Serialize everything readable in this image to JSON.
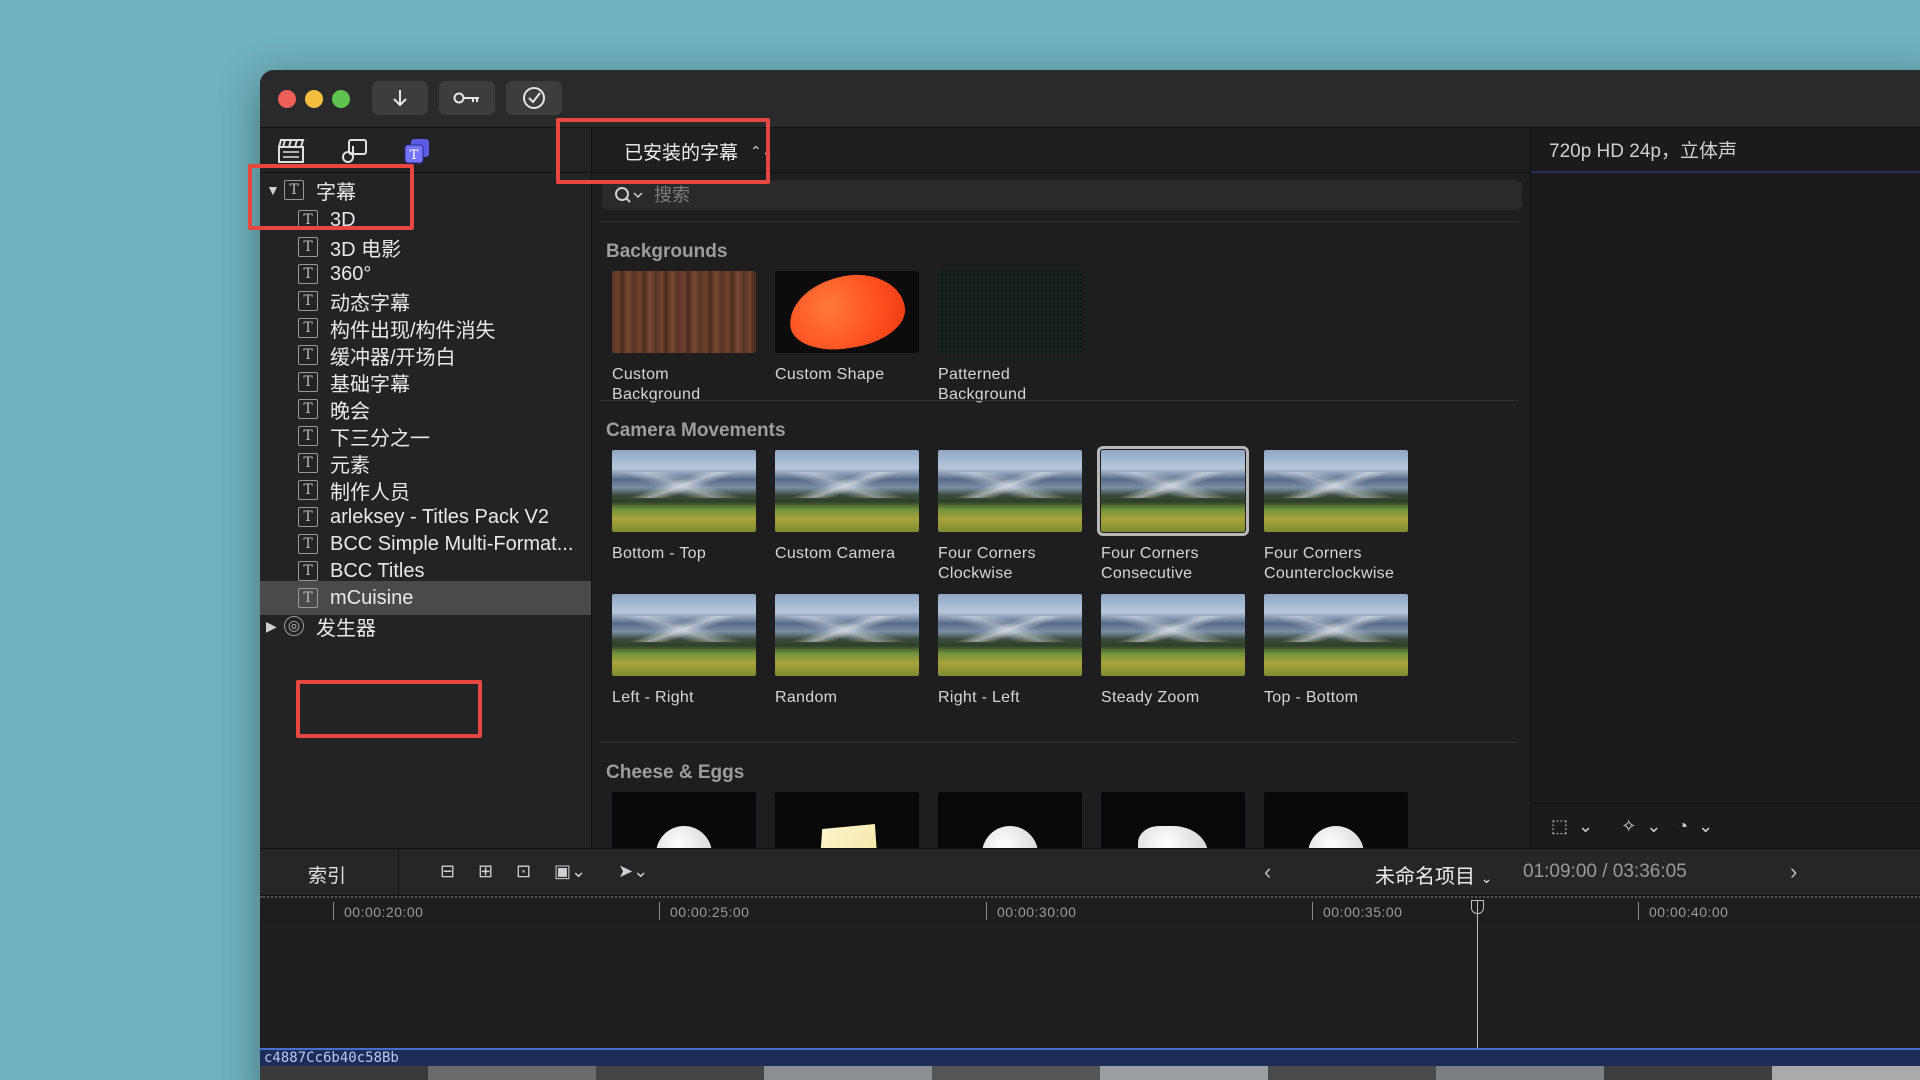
{
  "toolbar": {
    "import_icon": "arrow-down-icon",
    "keyword_icon": "key-icon",
    "background_tasks_icon": "checkmark-circle-icon"
  },
  "library_tabs": [
    {
      "icon": "clapperboard-icon"
    },
    {
      "icon": "music-photos-icon"
    },
    {
      "icon": "titles-generators-icon",
      "active": true
    }
  ],
  "sidebar": {
    "items": [
      {
        "label": "字幕",
        "expanded": true
      },
      {
        "label": "3D"
      },
      {
        "label": "3D 电影"
      },
      {
        "label": "360°"
      },
      {
        "label": "动态字幕"
      },
      {
        "label": "构件出现/构件消失"
      },
      {
        "label": "缓冲器/开场白"
      },
      {
        "label": "基础字幕"
      },
      {
        "label": "晚会"
      },
      {
        "label": "下三分之一"
      },
      {
        "label": "元素"
      },
      {
        "label": "制作人员"
      },
      {
        "label": "arleksey - Titles Pack V2"
      },
      {
        "label": "BCC Simple Multi-Format..."
      },
      {
        "label": "BCC Titles"
      },
      {
        "label": "mCuisine",
        "selected": true
      },
      {
        "label": "发生器",
        "expanded": false
      }
    ]
  },
  "browser": {
    "dropdown_label": "已安装的字幕",
    "search_placeholder": "搜索",
    "sections": [
      {
        "title": "Backgrounds",
        "tiles": [
          {
            "label": "Custom Background"
          },
          {
            "label": "Custom Shape"
          },
          {
            "label": "Patterned Background"
          }
        ]
      },
      {
        "title": "Camera Movements",
        "tiles": [
          {
            "label": "Bottom - Top"
          },
          {
            "label": "Custom Camera"
          },
          {
            "label": "Four Corners Clockwise"
          },
          {
            "label": "Four Corners Consecutive",
            "selected": true
          },
          {
            "label": "Four Corners Counterclockwise"
          },
          {
            "label": "Left - Right"
          },
          {
            "label": "Random"
          },
          {
            "label": "Right - Left"
          },
          {
            "label": "Steady Zoom"
          },
          {
            "label": "Top - Bottom"
          }
        ]
      },
      {
        "title": "Cheese & Eggs",
        "tiles": [
          {},
          {},
          {},
          {},
          {}
        ]
      }
    ]
  },
  "viewer": {
    "format": "720p HD 24p，立体声"
  },
  "timeline": {
    "index_label": "索引",
    "project_name": "未命名项目",
    "timecode": "01:09:00 / 03:36:05",
    "ruler_labels": [
      "00:00:20:00",
      "00:00:25:00",
      "00:00:30:00",
      "00:00:35:00",
      "00:00:40:00"
    ],
    "clip_name": "c4887Cc6b40c58Bb"
  },
  "colors": {
    "annotation": "#e8473f",
    "desktop": "#6fb1bd",
    "clip": "#1c2d58"
  }
}
